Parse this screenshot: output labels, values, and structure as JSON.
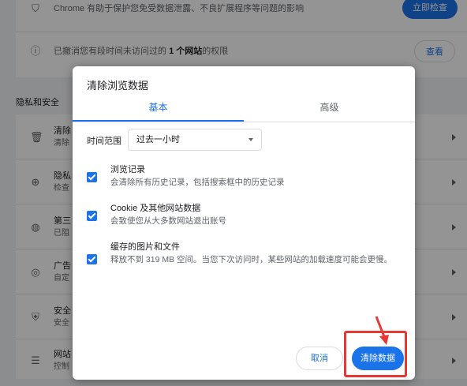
{
  "background": {
    "safety_row": {
      "text": "Chrome 有助于保护您免受数据泄露、不良扩展程序等问题的影响",
      "button": "立即检查"
    },
    "permissions_row": {
      "text_before": "已撤消您有段时间未访问过的 ",
      "text_bold": "1 个网站",
      "text_after": "的权限",
      "button": "查看"
    },
    "section_title": "隐私和安全",
    "items": [
      {
        "title": "清除",
        "sub": "清除"
      },
      {
        "title": "隐私",
        "sub": "检查"
      },
      {
        "title": "第三",
        "sub": "已阻"
      },
      {
        "title": "广告",
        "sub": "自定"
      },
      {
        "title": "安全",
        "sub": "安全"
      },
      {
        "title": "网站",
        "sub": "控制"
      }
    ]
  },
  "dialog": {
    "title": "清除浏览数据",
    "tabs": [
      {
        "label": "基本"
      },
      {
        "label": "高级"
      }
    ],
    "time_range": {
      "label": "时间范围",
      "value": "过去一小时"
    },
    "options": [
      {
        "title": "浏览记录",
        "desc": "会清除所有历史记录，包括搜索框中的历史记录"
      },
      {
        "title": "Cookie 及其他网站数据",
        "desc": "会致使您从大多数网站退出账号"
      },
      {
        "title": "缓存的图片和文件",
        "desc": "释放不到 319 MB 空间。当您下次访问时，某些网站的加载速度可能会更慢。"
      }
    ],
    "cancel_label": "取消",
    "confirm_label": "清除数据"
  },
  "colors": {
    "accent": "#1a73e8",
    "highlight": "#e53935"
  }
}
